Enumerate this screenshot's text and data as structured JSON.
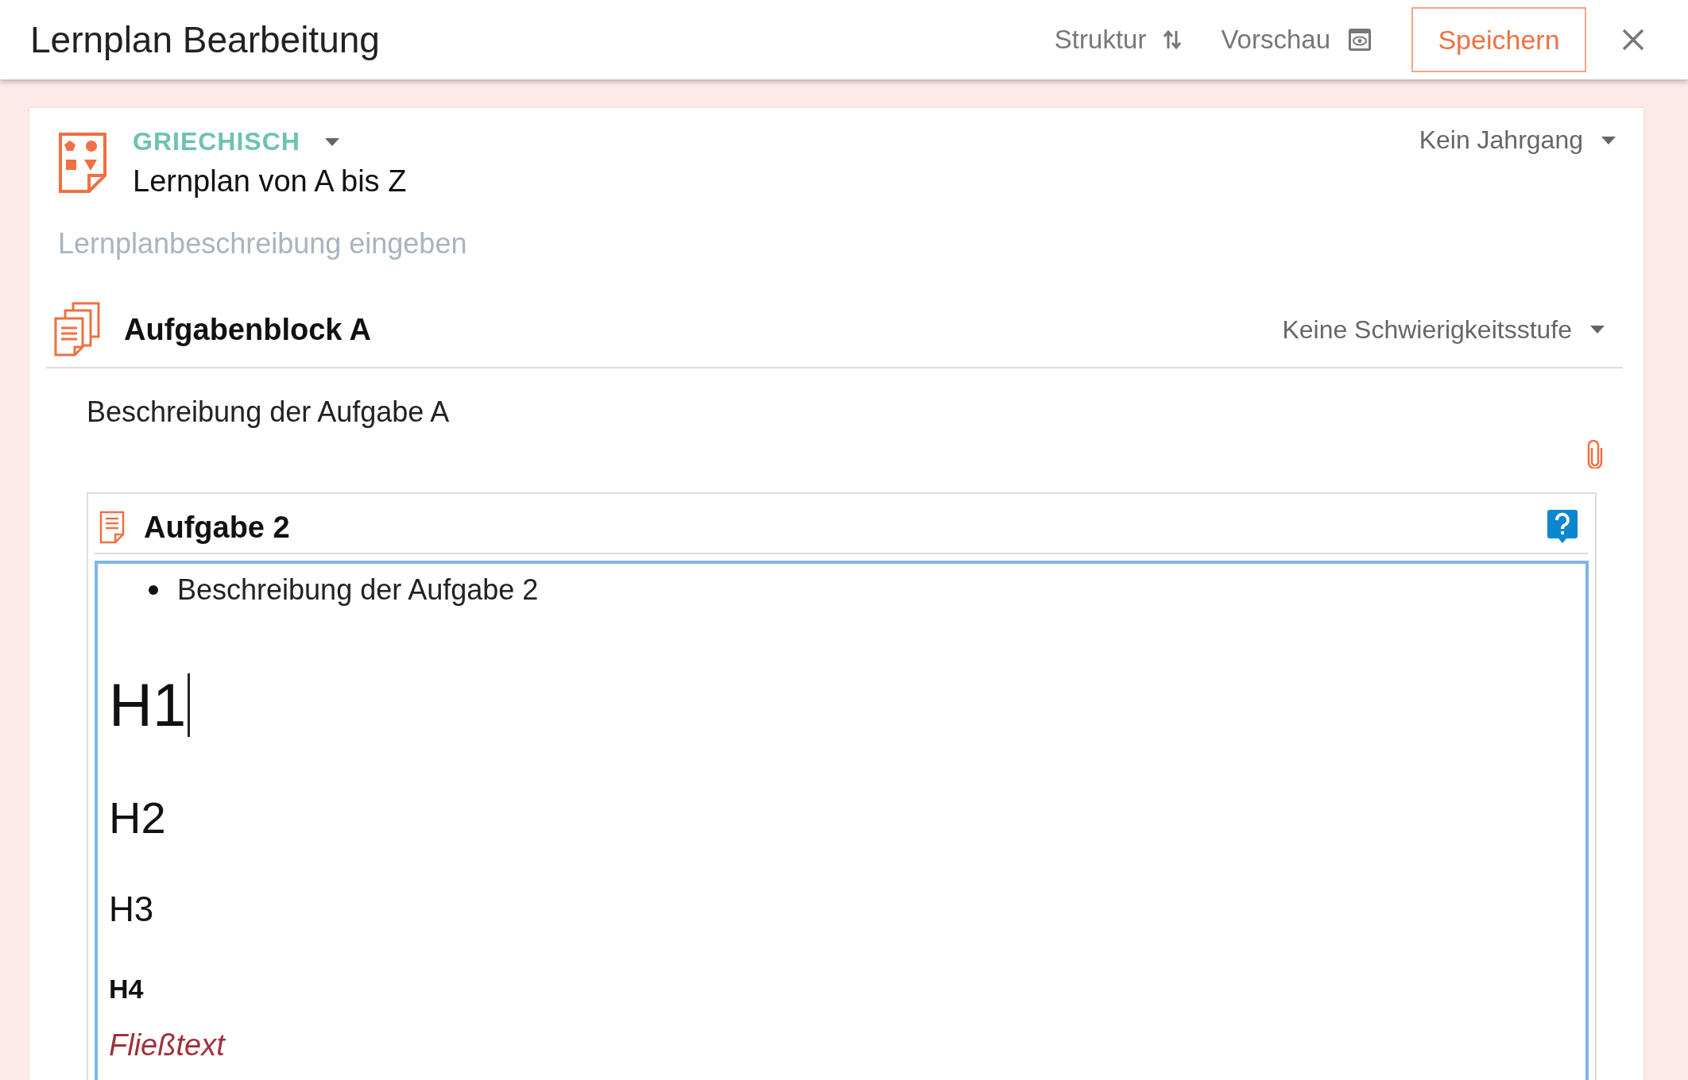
{
  "header": {
    "title": "Lernplan Bearbeitung",
    "actions": [
      {
        "label": "Struktur",
        "kind": "structure"
      },
      {
        "label": "Vorschau",
        "kind": "preview"
      }
    ],
    "save_button": "Speichern"
  },
  "plan": {
    "subject": "GRIECHISCH",
    "title": "Lernplan von A bis Z",
    "grade": "Kein Jahrgang",
    "description": {
      "placeholder": "Lernplanbeschreibung eingeben"
    }
  },
  "block": {
    "title": "Aufgabenblock A",
    "difficulty": "Keine Schwierigkeitsstufe",
    "description": "Beschreibung der Aufgabe A"
  },
  "task": {
    "title": "Aufgabe 2",
    "editor": {
      "content": [
        {
          "kind": "bullet",
          "text": "Beschreibung der Aufgabe 2",
          "caret": false
        },
        {
          "kind": "h1",
          "text": "H1",
          "caret": true
        },
        {
          "kind": "h2",
          "text": "H2",
          "caret": false
        },
        {
          "kind": "h3",
          "text": "H3",
          "caret": false
        },
        {
          "kind": "h4",
          "text": "H4",
          "caret": false
        },
        {
          "kind": "paragraph",
          "text": "Fließtext",
          "caret": false
        }
      ]
    }
  }
}
